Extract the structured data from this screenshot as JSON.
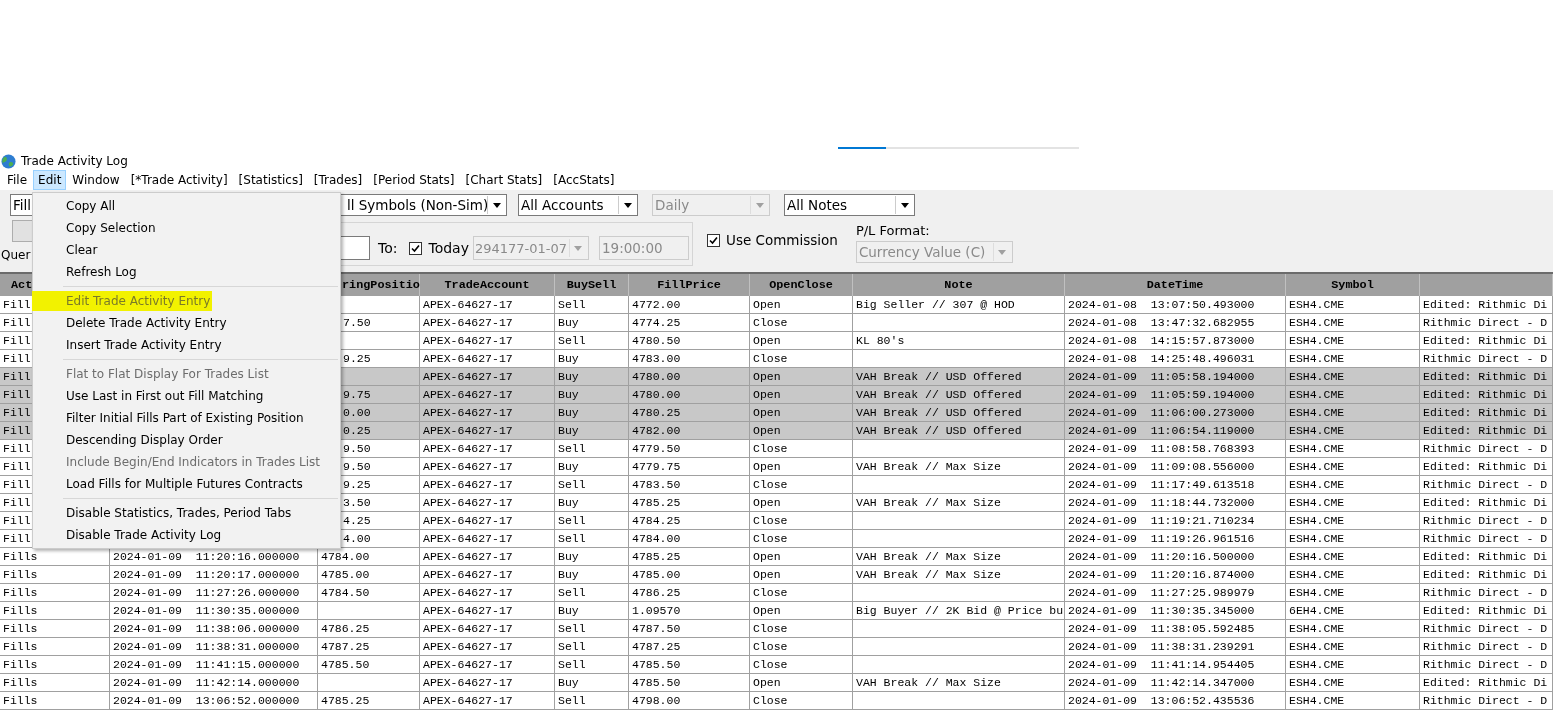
{
  "progress": {
    "level": 0.2
  },
  "window": {
    "title": "Trade Activity Log"
  },
  "menu_bar": [
    {
      "label": "File",
      "selected": false
    },
    {
      "label": "Edit",
      "selected": true
    },
    {
      "label": "Window",
      "selected": false
    },
    {
      "label": "[*Trade Activity]",
      "selected": false
    },
    {
      "label": "[Statistics]",
      "selected": false
    },
    {
      "label": "[Trades]",
      "selected": false
    },
    {
      "label": "[Period Stats]",
      "selected": false
    },
    {
      "label": "[Chart Stats]",
      "selected": false
    },
    {
      "label": "[AccStats]",
      "selected": false
    }
  ],
  "filters": [
    {
      "value": "Fill",
      "disabled": false
    },
    {
      "value": "ll Symbols (Non-Sim)",
      "disabled": false
    },
    {
      "value": "All Accounts",
      "disabled": false
    },
    {
      "value": "Daily",
      "disabled": true
    },
    {
      "value": "All Notes",
      "disabled": false
    }
  ],
  "query_label": "Quer",
  "range": {
    "to_label": "To:",
    "today": {
      "label": "Today",
      "checked": true
    },
    "date": {
      "value": "294177-01-07",
      "disabled": true
    },
    "time": {
      "value": "19:00:00",
      "disabled": true
    }
  },
  "use_commission": {
    "label": "Use Commission",
    "checked": true
  },
  "pl_format": {
    "label": "P/L Format:",
    "value": "Currency Value (C)",
    "disabled": true
  },
  "edit_menu": [
    {
      "kind": "item",
      "label": "Copy All",
      "disabled": false,
      "highlighted": false
    },
    {
      "kind": "item",
      "label": "Copy Selection",
      "disabled": false,
      "highlighted": false
    },
    {
      "kind": "item",
      "label": "Clear",
      "disabled": false,
      "highlighted": false
    },
    {
      "kind": "item",
      "label": "Refresh Log",
      "disabled": false,
      "highlighted": false
    },
    {
      "kind": "separator"
    },
    {
      "kind": "item",
      "label": "Edit Trade Activity Entry",
      "disabled": true,
      "highlighted": true
    },
    {
      "kind": "item",
      "label": "Delete Trade Activity Entry",
      "disabled": false,
      "highlighted": false
    },
    {
      "kind": "item",
      "label": "Insert Trade Activity Entry",
      "disabled": false,
      "highlighted": false
    },
    {
      "kind": "separator"
    },
    {
      "kind": "item",
      "label": "Flat to Flat Display For Trades List",
      "disabled": true,
      "highlighted": false
    },
    {
      "kind": "item",
      "label": "Use Last in First out Fill Matching",
      "disabled": false,
      "highlighted": false
    },
    {
      "kind": "item",
      "label": "Filter Initial Fills Part of Existing Position",
      "disabled": false,
      "highlighted": false
    },
    {
      "kind": "item",
      "label": "Descending Display Order",
      "disabled": false,
      "highlighted": false
    },
    {
      "kind": "item",
      "label": "Include Begin/End Indicators in Trades List",
      "disabled": true,
      "highlighted": false
    },
    {
      "kind": "item",
      "label": "Load Fills for Multiple Futures Contracts",
      "disabled": false,
      "highlighted": false
    },
    {
      "kind": "separator"
    },
    {
      "kind": "item",
      "label": "Disable Statistics, Trades, Period Tabs",
      "disabled": false,
      "highlighted": false
    },
    {
      "kind": "item",
      "label": "Disable Trade Activity Log",
      "disabled": false,
      "highlighted": false
    }
  ],
  "table": {
    "columns": {
      "activity": "Act",
      "column_3": "ringPositio",
      "trade_account": "TradeAccount",
      "buy_sell": "BuySell",
      "fill_price": "FillPrice",
      "open_close": "OpenClose",
      "note": "Note",
      "date_time": "DateTime",
      "symbol": "Symbol"
    },
    "rows": [
      {
        "selected": false,
        "activity": "Fill",
        "trade_account": "APEX-64627-17",
        "buy_sell": "Sell",
        "fill_price": "4772.00",
        "open_close": "Open",
        "note": "Big Seller // 307 @ HOD",
        "date_time": "2024-01-08  13:07:50.493000",
        "symbol": "ESH4.CME",
        "column_11": "Edited: Rithmic Di"
      },
      {
        "selected": false,
        "activity": "Fill",
        "column_3": "7.50",
        "trade_account": "APEX-64627-17",
        "buy_sell": "Buy",
        "fill_price": "4774.25",
        "open_close": "Close",
        "date_time": "2024-01-08  13:47:32.682955",
        "symbol": "ESH4.CME",
        "column_11": "Rithmic Direct - D"
      },
      {
        "selected": false,
        "activity": "Fill",
        "trade_account": "APEX-64627-17",
        "buy_sell": "Sell",
        "fill_price": "4780.50",
        "open_close": "Open",
        "note": "KL 80's",
        "date_time": "2024-01-08  14:15:57.873000",
        "symbol": "ESH4.CME",
        "column_11": "Edited: Rithmic Di"
      },
      {
        "selected": false,
        "activity": "Fill",
        "column_3": "9.25",
        "trade_account": "APEX-64627-17",
        "buy_sell": "Buy",
        "fill_price": "4783.00",
        "open_close": "Close",
        "date_time": "2024-01-08  14:25:48.496031",
        "symbol": "ESH4.CME",
        "column_11": "Rithmic Direct - D"
      },
      {
        "selected": true,
        "activity": "Fill",
        "trade_account": "APEX-64627-17",
        "buy_sell": "Buy",
        "fill_price": "4780.00",
        "open_close": "Open",
        "note": "VAH Break // USD Offered",
        "date_time": "2024-01-09  11:05:58.194000",
        "symbol": "ESH4.CME",
        "column_11": "Edited: Rithmic Di"
      },
      {
        "selected": true,
        "activity": "Fill",
        "column_3": "9.75",
        "trade_account": "APEX-64627-17",
        "buy_sell": "Buy",
        "fill_price": "4780.00",
        "open_close": "Open",
        "note": "VAH Break // USD Offered",
        "date_time": "2024-01-09  11:05:59.194000",
        "symbol": "ESH4.CME",
        "column_11": "Edited: Rithmic Di"
      },
      {
        "selected": true,
        "activity": "Fill",
        "column_3": "0.00",
        "trade_account": "APEX-64627-17",
        "buy_sell": "Buy",
        "fill_price": "4780.25",
        "open_close": "Open",
        "note": "VAH Break // USD Offered",
        "date_time": "2024-01-09  11:06:00.273000",
        "symbol": "ESH4.CME",
        "column_11": "Edited: Rithmic Di"
      },
      {
        "selected": true,
        "activity": "Fill",
        "column_3": "0.25",
        "trade_account": "APEX-64627-17",
        "buy_sell": "Buy",
        "fill_price": "4782.00",
        "open_close": "Open",
        "note": "VAH Break // USD Offered",
        "date_time": "2024-01-09  11:06:54.119000",
        "symbol": "ESH4.CME",
        "column_11": "Edited: Rithmic Di"
      },
      {
        "selected": false,
        "activity": "Fill",
        "column_3": "9.50",
        "trade_account": "APEX-64627-17",
        "buy_sell": "Sell",
        "fill_price": "4779.50",
        "open_close": "Close",
        "date_time": "2024-01-09  11:08:58.768393",
        "symbol": "ESH4.CME",
        "column_11": "Rithmic Direct - D"
      },
      {
        "selected": false,
        "activity": "Fill",
        "column_3": "9.50",
        "trade_account": "APEX-64627-17",
        "buy_sell": "Buy",
        "fill_price": "4779.75",
        "open_close": "Open",
        "note": "VAH Break // Max Size",
        "date_time": "2024-01-09  11:09:08.556000",
        "symbol": "ESH4.CME",
        "column_11": "Edited: Rithmic Di"
      },
      {
        "selected": false,
        "activity": "Fill",
        "column_3": "9.25",
        "trade_account": "APEX-64627-17",
        "buy_sell": "Sell",
        "fill_price": "4783.50",
        "open_close": "Close",
        "date_time": "2024-01-09  11:17:49.613518",
        "symbol": "ESH4.CME",
        "column_11": "Rithmic Direct - D"
      },
      {
        "selected": false,
        "activity": "Fill",
        "column_3": "3.50",
        "trade_account": "APEX-64627-17",
        "buy_sell": "Buy",
        "fill_price": "4785.25",
        "open_close": "Open",
        "note": "VAH Break // Max Size",
        "date_time": "2024-01-09  11:18:44.732000",
        "symbol": "ESH4.CME",
        "column_11": "Edited: Rithmic Di"
      },
      {
        "selected": false,
        "activity": "Fill",
        "column_3": "4.25",
        "trade_account": "APEX-64627-17",
        "buy_sell": "Sell",
        "fill_price": "4784.25",
        "open_close": "Close",
        "date_time": "2024-01-09  11:19:21.710234",
        "symbol": "ESH4.CME",
        "column_11": "Rithmic Direct - D"
      },
      {
        "selected": false,
        "activity": "Fill",
        "column_3": "4.00",
        "trade_account": "APEX-64627-17",
        "buy_sell": "Sell",
        "fill_price": "4784.00",
        "open_close": "Close",
        "date_time": "2024-01-09  11:19:26.961516",
        "symbol": "ESH4.CME",
        "column_11": "Rithmic Direct - D"
      },
      {
        "selected": false,
        "activity": "Fills",
        "column_2": "2024-01-09  11:20:16.000000",
        "column_3": "4784.00",
        "trade_account": "APEX-64627-17",
        "buy_sell": "Buy",
        "fill_price": "4785.25",
        "open_close": "Open",
        "note": "VAH Break // Max Size",
        "date_time": "2024-01-09  11:20:16.500000",
        "symbol": "ESH4.CME",
        "column_11": "Edited: Rithmic Di"
      },
      {
        "selected": false,
        "activity": "Fills",
        "column_2": "2024-01-09  11:20:17.000000",
        "column_3": "4785.00",
        "trade_account": "APEX-64627-17",
        "buy_sell": "Buy",
        "fill_price": "4785.00",
        "open_close": "Open",
        "note": "VAH Break // Max Size",
        "date_time": "2024-01-09  11:20:16.874000",
        "symbol": "ESH4.CME",
        "column_11": "Edited: Rithmic Di"
      },
      {
        "selected": false,
        "activity": "Fills",
        "column_2": "2024-01-09  11:27:26.000000",
        "column_3": "4784.50",
        "trade_account": "APEX-64627-17",
        "buy_sell": "Sell",
        "fill_price": "4786.25",
        "open_close": "Close",
        "date_time": "2024-01-09  11:27:25.989979",
        "symbol": "ESH4.CME",
        "column_11": "Rithmic Direct - D"
      },
      {
        "selected": false,
        "activity": "Fills",
        "column_2": "2024-01-09  11:30:35.000000",
        "trade_account": "APEX-64627-17",
        "buy_sell": "Buy",
        "fill_price": "1.09570",
        "open_close": "Open",
        "note": "Big Buyer // 2K Bid @ Price bu",
        "date_time": "2024-01-09  11:30:35.345000",
        "symbol": "6EH4.CME",
        "column_11": "Edited: Rithmic Di"
      },
      {
        "selected": false,
        "activity": "Fills",
        "column_2": "2024-01-09  11:38:06.000000",
        "column_3": "4786.25",
        "trade_account": "APEX-64627-17",
        "buy_sell": "Sell",
        "fill_price": "4787.50",
        "open_close": "Close",
        "date_time": "2024-01-09  11:38:05.592485",
        "symbol": "ESH4.CME",
        "column_11": "Rithmic Direct - D"
      },
      {
        "selected": false,
        "activity": "Fills",
        "column_2": "2024-01-09  11:38:31.000000",
        "column_3": "4787.25",
        "trade_account": "APEX-64627-17",
        "buy_sell": "Sell",
        "fill_price": "4787.25",
        "open_close": "Close",
        "date_time": "2024-01-09  11:38:31.239291",
        "symbol": "ESH4.CME",
        "column_11": "Rithmic Direct - D"
      },
      {
        "selected": false,
        "activity": "Fills",
        "column_2": "2024-01-09  11:41:15.000000",
        "column_3": "4785.50",
        "trade_account": "APEX-64627-17",
        "buy_sell": "Sell",
        "fill_price": "4785.50",
        "open_close": "Close",
        "date_time": "2024-01-09  11:41:14.954405",
        "symbol": "ESH4.CME",
        "column_11": "Rithmic Direct - D"
      },
      {
        "selected": false,
        "activity": "Fills",
        "column_2": "2024-01-09  11:42:14.000000",
        "trade_account": "APEX-64627-17",
        "buy_sell": "Buy",
        "fill_price": "4785.50",
        "open_close": "Open",
        "note": "VAH Break // Max Size",
        "date_time": "2024-01-09  11:42:14.347000",
        "symbol": "ESH4.CME",
        "column_11": "Edited: Rithmic Di"
      },
      {
        "selected": false,
        "activity": "Fills",
        "column_2": "2024-01-09  13:06:52.000000",
        "column_3": "4785.25",
        "trade_account": "APEX-64627-17",
        "buy_sell": "Sell",
        "fill_price": "4798.00",
        "open_close": "Close",
        "date_time": "2024-01-09  13:06:52.435536",
        "symbol": "ESH4.CME",
        "column_11": "Rithmic Direct - D"
      }
    ]
  }
}
